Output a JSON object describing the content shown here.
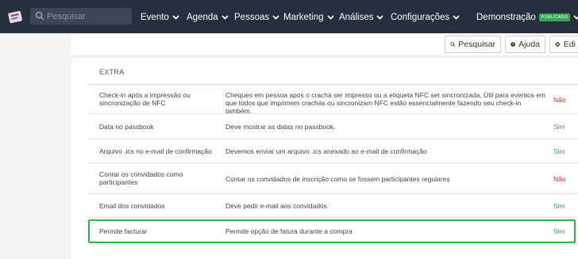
{
  "search": {
    "placeholder": "Pesquisar"
  },
  "nav": {
    "items": [
      "Evento",
      "Agenda",
      "Pessoas",
      "Marketing",
      "Análises",
      "Configurações"
    ],
    "demo_label": "Demonstração",
    "badge": "PUBLICADO"
  },
  "toolbar": {
    "search_label": "Pesquisar",
    "help_label": "Ajuda",
    "edit_label": "Edi"
  },
  "section": {
    "title": "EXTRA"
  },
  "rows": [
    {
      "name": "Check-in após a impressão ou sincronização de NFC",
      "desc": "Cheques em pessoa após o crachá ser impresso ou a etiqueta NFC ser sincronizada. Útil para eventos em que todos que imprimem crachás ou sincronizam NFC estão essencialmente fazendo seu check-in também.",
      "value": "Não"
    },
    {
      "name": "Data no passbook",
      "desc": "Deve mostrar as datas no passbook.",
      "value": "Sim"
    },
    {
      "name": "Arquivo .ics no e-mail de confirmação",
      "desc": "Devemos enviar um arquivo .ics anexado ao e-mail de confirmação",
      "value": "Sim"
    },
    {
      "name": "Contar os convidados como participantes",
      "desc": "Contar os convidados de inscrição como se fossem participantes regulares",
      "value": "Não"
    },
    {
      "name": "Email dos convidados",
      "desc": "Deve pedir e-mail aos convidados",
      "value": "Sim"
    },
    {
      "name": "Permite facturar",
      "desc": "Permite opção de fatura durante a compra",
      "value": "Sim"
    }
  ],
  "colors": {
    "nav_bg": "#262f3d",
    "yes": "#3aa757",
    "no": "#e02424",
    "highlight": "#28b84a"
  }
}
